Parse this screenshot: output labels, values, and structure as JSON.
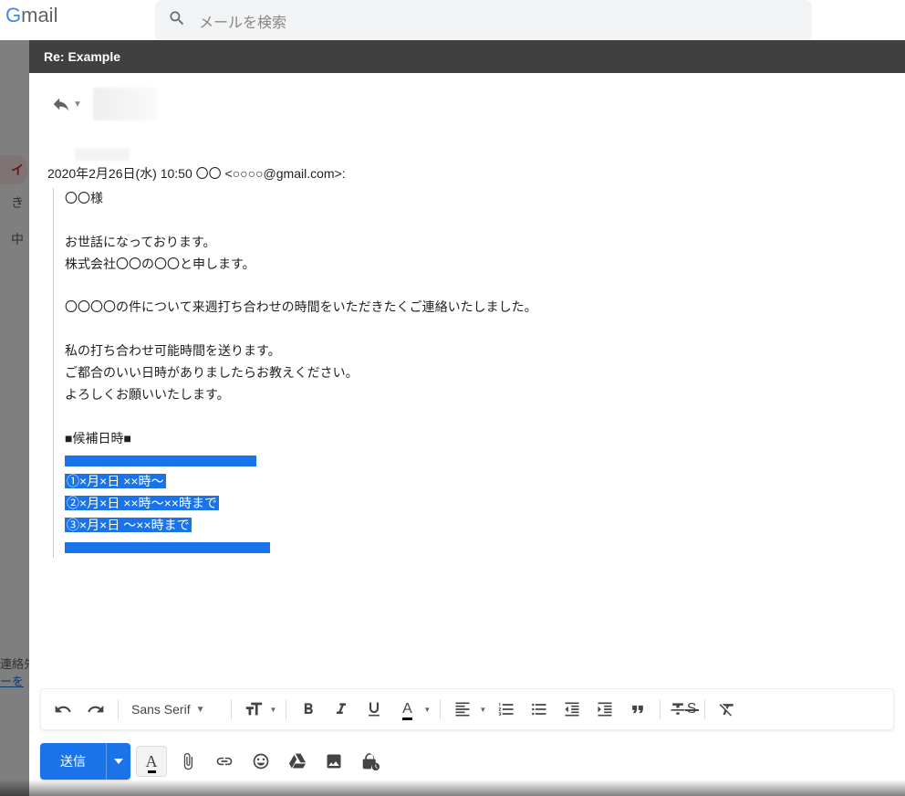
{
  "logo": "Gmail",
  "search_placeholder": "メールを検索",
  "sidebar": {
    "selected": "イ",
    "item2": "き",
    "item3": "中"
  },
  "contacts": {
    "line1": "連絡先",
    "link": "ーを"
  },
  "compose": {
    "title": "Re: Example",
    "quote_header": "2020年2月26日(水) 10:50 〇〇 <○○○○@gmail.com>:",
    "body": {
      "l1": "〇〇様",
      "l2": "お世話になっております。",
      "l3": "株式会社〇〇の〇〇と申します。",
      "l4": "〇〇〇〇の件について来週打ち合わせの時間をいただきたくご連絡いたしました。",
      "l5": "私の打ち合わせ可能時間を送ります。",
      "l6": "ご都合のいい日時がありましたらお教えください。",
      "l7": "よろしくお願いいたします。",
      "l8": "■候補日時■",
      "h1": "①×月×日 ××時～",
      "h2": "②×月×日 ××時～××時まで",
      "h3": "③×月×日 ～××時まで"
    }
  },
  "toolbar": {
    "font": "Sans Serif",
    "send": "送信"
  }
}
